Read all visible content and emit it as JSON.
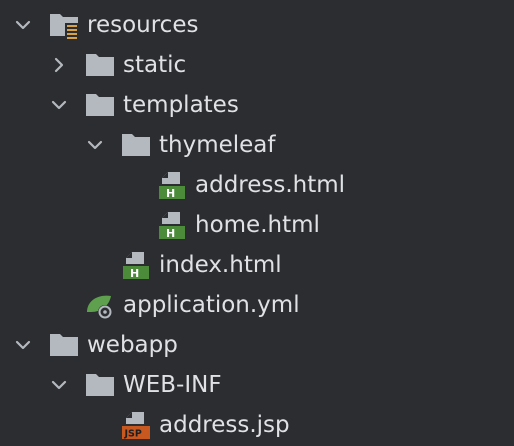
{
  "tree": {
    "items": [
      {
        "label": "resources",
        "expanded": true,
        "icon": "resources-folder-icon"
      },
      {
        "label": "static",
        "expanded": false,
        "icon": "folder-icon"
      },
      {
        "label": "templates",
        "expanded": true,
        "icon": "folder-icon"
      },
      {
        "label": "thymeleaf",
        "expanded": true,
        "icon": "folder-icon"
      },
      {
        "label": "address.html",
        "icon": "html-file-icon"
      },
      {
        "label": "home.html",
        "icon": "html-file-icon"
      },
      {
        "label": "index.html",
        "icon": "html-file-icon"
      },
      {
        "label": "application.yml",
        "icon": "spring-config-icon"
      },
      {
        "label": "webapp",
        "expanded": true,
        "icon": "folder-icon"
      },
      {
        "label": "WEB-INF",
        "expanded": true,
        "icon": "folder-icon"
      },
      {
        "label": "address.jsp",
        "icon": "jsp-file-icon"
      }
    ]
  },
  "icons": {
    "html_badge": "H",
    "jsp_badge": "JSP"
  },
  "colors": {
    "background": "#2b2d30",
    "text": "#dfe1e5",
    "folder": "#b4b8bf",
    "html_green": "#4c8b3a",
    "jsp_orange": "#c7581f",
    "spring_green": "#5fa04e"
  }
}
